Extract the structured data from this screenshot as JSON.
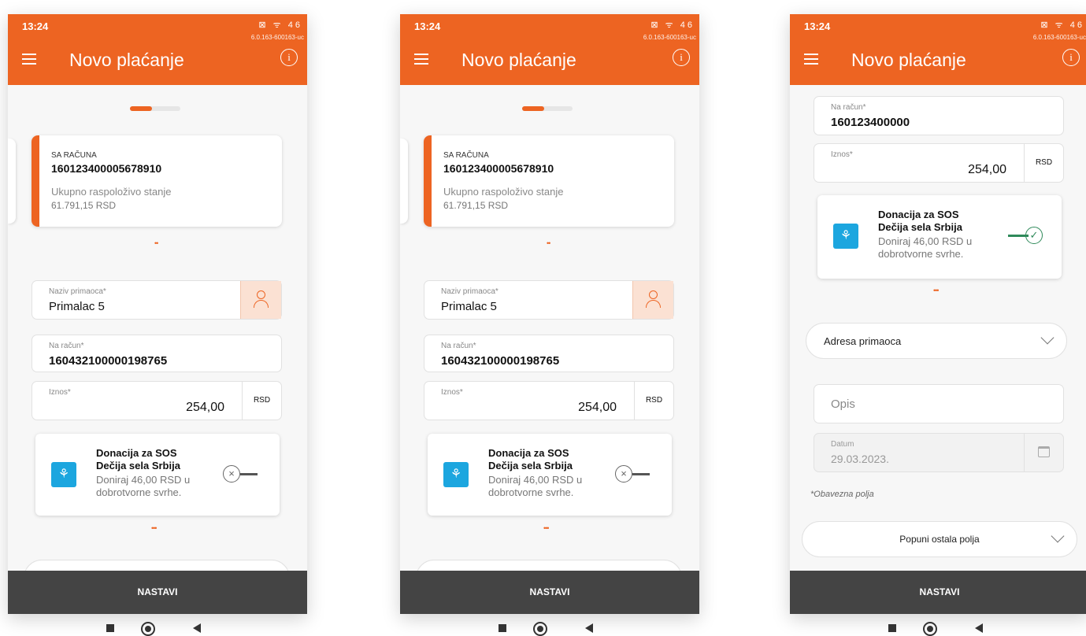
{
  "status_bar": {
    "time": "13:24",
    "icons": "⊠ ᯤ 46",
    "version": "6.0.163-600163-uc"
  },
  "app_bar": {
    "title": "Novo plaćanje",
    "info_glyph": "i"
  },
  "from_account": {
    "label": "SA RAČUNA",
    "number": "160123400005678910",
    "balance_label": "Ukupno raspoloživo stanje",
    "balance": "61.791,15 RSD"
  },
  "recipient": {
    "label": "Naziv primaoca*",
    "value": "Primalac 5"
  },
  "to_account_p1": {
    "label": "Na račun*",
    "value": "160432100000198765"
  },
  "to_account_p3": {
    "label": "Na račun*",
    "value": "160123400000"
  },
  "amount": {
    "label": "Iznos*",
    "value": "254,00",
    "currency": "RSD"
  },
  "donation": {
    "title_line1": "Donacija za SOS",
    "title_line2": "Dečija sela Srbija",
    "text": "Doniraj 46,00 RSD u dobrotvorne svrhe.",
    "logo": "sos-children-icon",
    "toggle_off_glyph": "×",
    "toggle_on_glyph": "✓"
  },
  "dots": "•••",
  "pager_dots": "••",
  "address_dropdown": {
    "label": "Adresa primaoca"
  },
  "description": {
    "placeholder": "Opis"
  },
  "date": {
    "label": "Datum",
    "value": "29.03.2023."
  },
  "required_note": "*Obavezna polja",
  "fill_other": {
    "label": "Popuni ostala polja"
  },
  "continue_button": "NASTAVI",
  "colors": {
    "brand": "#ed6422",
    "dark_bar": "#444444",
    "sos_blue": "#1ca6df",
    "toggle_on": "#2f8a5a"
  }
}
